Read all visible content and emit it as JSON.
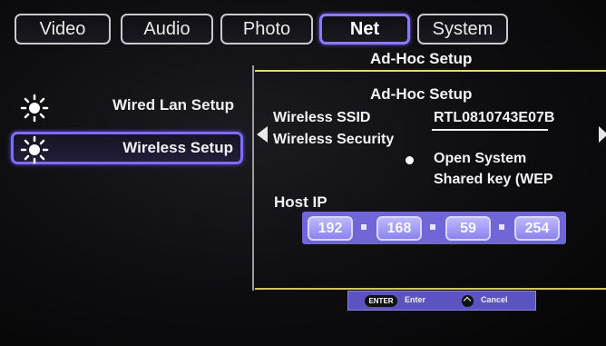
{
  "tabs": [
    {
      "label": "Video"
    },
    {
      "label": "Audio"
    },
    {
      "label": "Photo"
    },
    {
      "label": "Net",
      "active": true
    },
    {
      "label": "System"
    }
  ],
  "header": {
    "section_title": "Ad-Hoc Setup"
  },
  "sidebar": {
    "items": [
      {
        "label": "Wired Lan Setup",
        "icon": "sun-icon"
      },
      {
        "label": "Wireless Setup",
        "icon": "sun-icon",
        "selected": true
      }
    ]
  },
  "panel": {
    "title": "Ad-Hoc Setup",
    "ssid_label": "Wireless SSID",
    "ssid_value": "RTL0810743E07B",
    "security_label": "Wireless Security",
    "security_options": [
      {
        "label": "Open System",
        "selected": true
      },
      {
        "label": "Shared key (WEP"
      }
    ],
    "host_ip_label": "Host IP",
    "host_ip": [
      "192",
      "168",
      "59",
      "254"
    ]
  },
  "hints": {
    "enter_key": "ENTER",
    "enter_label": "Enter",
    "cancel_label": "Cancel"
  },
  "colors": {
    "accent": "#7e6cff",
    "divider": "#e3d76a",
    "ip_field": "#6f67d8"
  }
}
